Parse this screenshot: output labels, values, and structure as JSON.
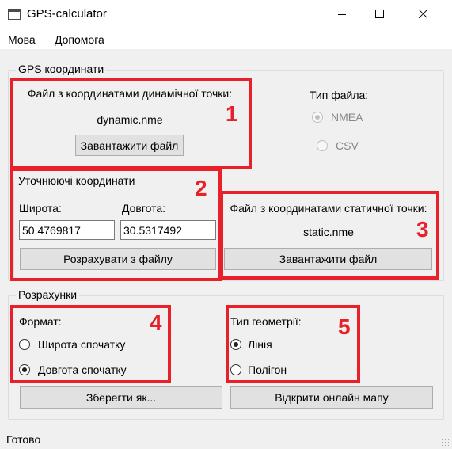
{
  "window": {
    "title": "GPS-calculator"
  },
  "menu": {
    "items": [
      "Мова",
      "Допомога"
    ]
  },
  "gps_group": {
    "title": "GPS координати",
    "dynamic": {
      "label": "Файл з координатами динамічної точки:",
      "filename": "dynamic.nme",
      "button": "Завантажити файл"
    },
    "file_type": {
      "label": "Тип файла:",
      "options": [
        {
          "label": "NMEA",
          "checked": true,
          "enabled": false
        },
        {
          "label": "CSV",
          "checked": false,
          "enabled": false
        }
      ]
    },
    "refined": {
      "title": "Уточнюючі координати",
      "lat_label": "Широта:",
      "lon_label": "Довгота:",
      "lat_value": "50.4769817",
      "lon_value": "30.5317492",
      "button": "Розрахувати з файлу"
    },
    "static": {
      "label": "Файл з координатами статичної точки:",
      "filename": "static.nme",
      "button": "Завантажити файл"
    }
  },
  "calc_group": {
    "title": "Розрахунки",
    "format": {
      "label": "Формат:",
      "options": [
        {
          "label": "Широта спочатку",
          "checked": false
        },
        {
          "label": "Довгота спочатку",
          "checked": true
        }
      ]
    },
    "geometry": {
      "label": "Тип геометрії:",
      "options": [
        {
          "label": "Лінія",
          "checked": true
        },
        {
          "label": "Полігон",
          "checked": false
        }
      ]
    },
    "save_button": "Зберегти як...",
    "map_button": "Відкрити онлайн мапу"
  },
  "annotations": [
    "1",
    "2",
    "3",
    "4",
    "5"
  ],
  "annotation_color": "#e8202a",
  "status": {
    "text": "Готово"
  }
}
